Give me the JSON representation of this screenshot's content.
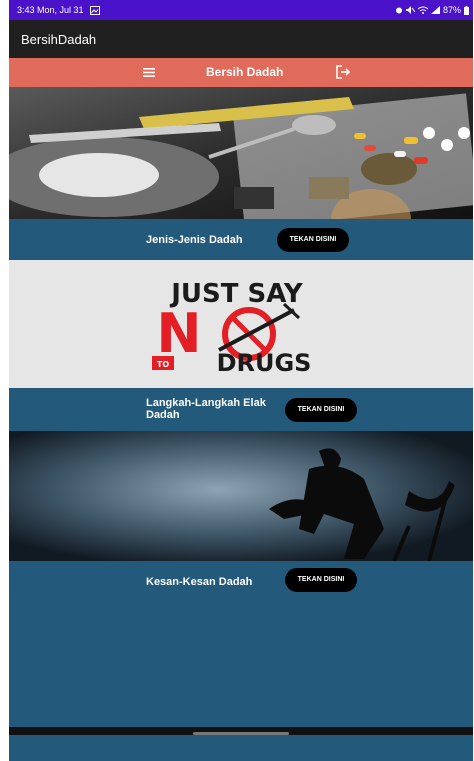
{
  "status_bar": {
    "time_date": "3:43  Mon, Jul 31",
    "battery": "87%"
  },
  "app_bar": {
    "title": "BersihDadah"
  },
  "header": {
    "title": "Bersih Dadah",
    "menu_icon": "hamburger-menu-icon",
    "logout_icon": "logout-icon"
  },
  "sections": [
    {
      "label": "Jenis-Jenis Dadah",
      "button": "TEKAN DISINI"
    },
    {
      "label": "Langkah-Langkah Elak Dadah",
      "button": "TEKAN DISINI"
    },
    {
      "label": "Kesan-Kesan Dadah",
      "button": "TEKAN DISINI"
    }
  ],
  "banner": {
    "line1": "JUST SAY",
    "big": "NO",
    "to": "TO",
    "line3": "DRUGS"
  },
  "colors": {
    "status_bar": "#4a12c9",
    "app_bar": "#202020",
    "header": "#e06b5b",
    "section_bg": "#23597b",
    "button": "#000000"
  }
}
